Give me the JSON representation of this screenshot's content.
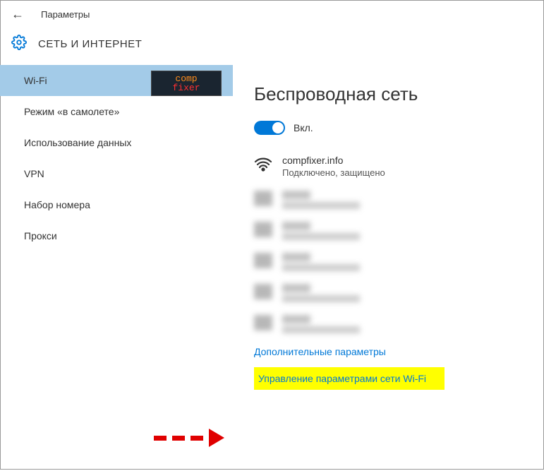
{
  "header": {
    "title": "Параметры"
  },
  "section": {
    "title": "СЕТЬ И ИНТЕРНЕТ"
  },
  "sidebar": {
    "items": [
      {
        "label": "Wi-Fi",
        "active": true
      },
      {
        "label": "Режим «в самолете»"
      },
      {
        "label": "Использование данных"
      },
      {
        "label": "VPN"
      },
      {
        "label": "Набор номера"
      },
      {
        "label": "Прокси"
      }
    ]
  },
  "logo": {
    "line1": "comp",
    "line2": "fixer"
  },
  "main": {
    "title": "Беспроводная сеть",
    "toggle_label": "Вкл.",
    "network": {
      "name": "compfixer.info",
      "status": "Подключено, защищено"
    },
    "link_advanced": "Дополнительные параметры",
    "link_manage": "Управление параметрами сети Wi-Fi"
  }
}
